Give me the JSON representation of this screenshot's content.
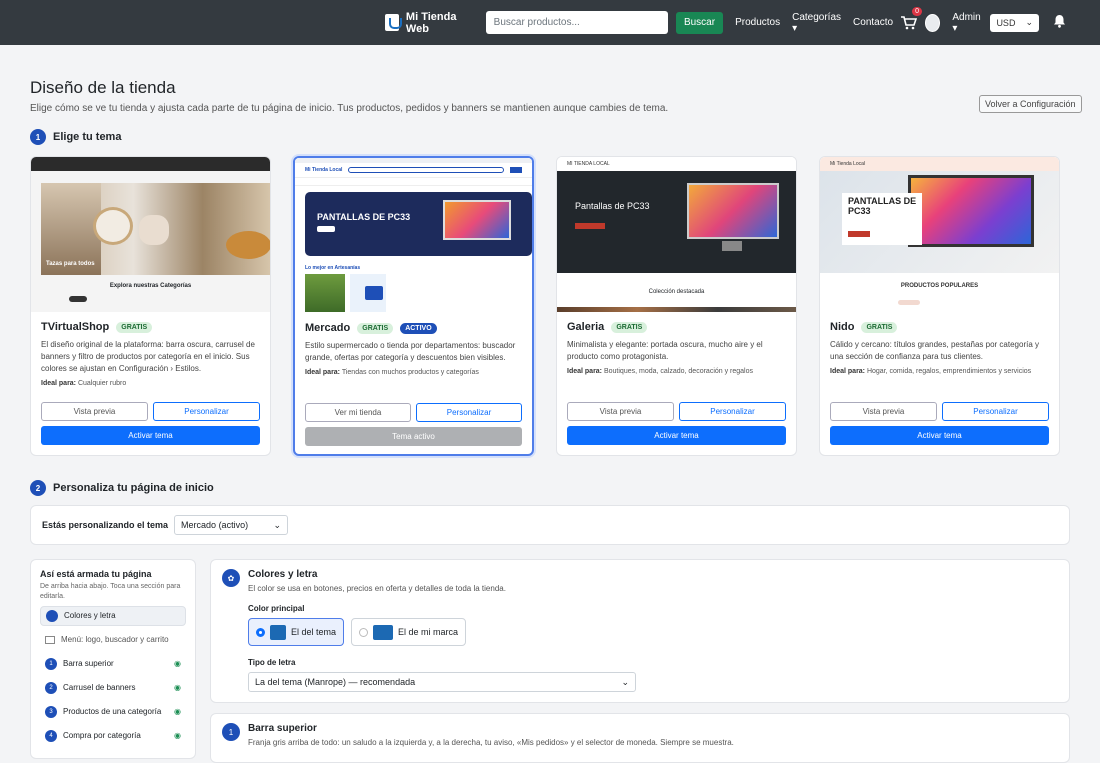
{
  "nav": {
    "brand": "Mi Tienda Web",
    "search_placeholder": "Buscar productos...",
    "search_btn": "Buscar",
    "links": [
      "Productos",
      "Categorías",
      "Contacto"
    ],
    "cart_count": "0",
    "user": "Admin",
    "currency": "USD"
  },
  "header": {
    "title": "Diseño de la tienda",
    "subtitle": "Elige cómo se ve tu tienda y ajusta cada parte de tu página de inicio. Tus productos, pedidos y banners se mantienen aunque cambies de tema.",
    "back": "Volver a Configuración"
  },
  "step1": {
    "num": "1",
    "label": "Elige tu tema"
  },
  "themes": [
    {
      "name": "TVirtualShop",
      "badge": "GRATIS",
      "desc": "El diseño original de la plataforma: barra oscura, carrusel de banners y filtro de productos por categoría en el inicio. Sus colores se ajustan en Configuración › Estilos.",
      "ideal_label": "Ideal para:",
      "ideal": "Cualquier rubro",
      "preview": "Vista previa",
      "customize": "Personalizar",
      "activate": "Activar tema",
      "thumb_caption": "Tazas para todos",
      "thumb_section": "Explora nuestras Categorías"
    },
    {
      "name": "Mercado",
      "badge": "GRATIS",
      "active_badge": "ACTIVO",
      "desc": "Estilo supermercado o tienda por departamentos: buscador grande, ofertas por categoría y descuentos bien visibles.",
      "ideal_label": "Ideal para:",
      "ideal": "Tiendas con muchos productos y categorías",
      "preview": "Ver mi tienda",
      "customize": "Personalizar",
      "activate": "Tema activo",
      "thumb_caption": "PANTALLAS DE PC33",
      "thumb_brand": "Mi Tienda Local"
    },
    {
      "name": "Galeria",
      "badge": "GRATIS",
      "desc": "Minimalista y elegante: portada oscura, mucho aire y el producto como protagonista.",
      "ideal_label": "Ideal para:",
      "ideal": "Boutiques, moda, calzado, decoración y regalos",
      "preview": "Vista previa",
      "customize": "Personalizar",
      "activate": "Activar tema",
      "thumb_caption": "Pantallas de PC33",
      "thumb_section": "Colección destacada",
      "thumb_brand": "MI TIENDA LOCAL"
    },
    {
      "name": "Nido",
      "badge": "GRATIS",
      "desc": "Cálido y cercano: títulos grandes, pestañas por categoría y una sección de confianza para tus clientes.",
      "ideal_label": "Ideal para:",
      "ideal": "Hogar, comida, regalos, emprendimientos y servicios",
      "preview": "Vista previa",
      "customize": "Personalizar",
      "activate": "Activar tema",
      "thumb_caption": "PANTALLAS DE PC33",
      "thumb_section": "PRODUCTOS POPULARES",
      "thumb_brand": "Mi Tienda Local"
    }
  ],
  "step2": {
    "num": "2",
    "label": "Personaliza tu página de inicio"
  },
  "editing": {
    "label": "Estás personalizando el tema",
    "value": "Mercado (activo)"
  },
  "sidebar": {
    "title": "Así está armada tu página",
    "desc": "De arriba hacia abajo. Toca una sección para editarla.",
    "items": [
      {
        "num": "",
        "label": "Colores y letra"
      },
      {
        "num": "",
        "label": "Menú: logo, buscador y carrito"
      },
      {
        "num": "1",
        "label": "Barra superior"
      },
      {
        "num": "2",
        "label": "Carrusel de banners"
      },
      {
        "num": "3",
        "label": "Productos de una categoría"
      },
      {
        "num": "4",
        "label": "Compra por categoría"
      }
    ]
  },
  "colors_panel": {
    "title": "Colores y letra",
    "desc": "El color se usa en botones, precios en oferta y detalles de toda la tienda.",
    "color_label": "Color principal",
    "opt1": "El del tema",
    "opt2": "El de mi marca",
    "font_label": "Tipo de letra",
    "font_value": "La del tema (Manrope) — recomendada"
  },
  "topbar_panel": {
    "num": "1",
    "title": "Barra superior",
    "desc": "Franja gris arriba de todo: un saludo a la izquierda y, a la derecha, tu aviso, «Mis pedidos» y el selector de moneda. Siempre se muestra."
  },
  "colors": {
    "accent": "#0d6efd",
    "nav": "#343a40",
    "active_border": "#4f7de9",
    "brand_swatch": "#1c69b3"
  }
}
